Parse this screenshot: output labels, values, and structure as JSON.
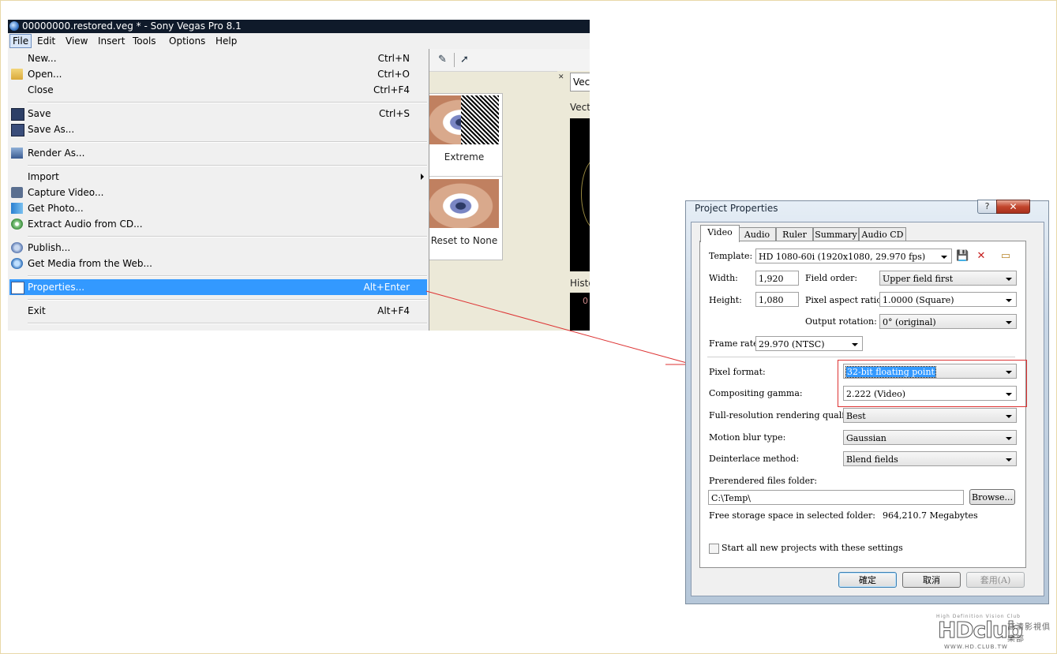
{
  "vegas": {
    "title": "00000000.restored.veg * - Sony Vegas Pro 8.1",
    "menubar": [
      "File",
      "Edit",
      "View",
      "Insert",
      "Tools",
      "Options",
      "Help"
    ],
    "file_menu": [
      {
        "label": "New...",
        "shortcut": "Ctrl+N",
        "icon": "new-icon"
      },
      {
        "label": "Open...",
        "shortcut": "Ctrl+O",
        "icon": "folder-icon"
      },
      {
        "label": "Close",
        "shortcut": "Ctrl+F4",
        "icon": ""
      },
      {
        "label": "Save",
        "shortcut": "Ctrl+S",
        "icon": "disk-icon"
      },
      {
        "label": "Save As...",
        "shortcut": "",
        "icon": "save-as-icon"
      },
      {
        "label": "Render As...",
        "shortcut": "",
        "icon": "render-icon"
      },
      {
        "label": "Import",
        "shortcut": "",
        "icon": "",
        "submenu": true
      },
      {
        "label": "Capture Video...",
        "shortcut": "",
        "icon": "camera-icon"
      },
      {
        "label": "Get Photo...",
        "shortcut": "",
        "icon": "photo-icon"
      },
      {
        "label": "Extract Audio from CD...",
        "shortcut": "",
        "icon": "cd-icon"
      },
      {
        "label": "Publish...",
        "shortcut": "",
        "icon": "publish-icon"
      },
      {
        "label": "Get Media from the Web...",
        "shortcut": "",
        "icon": "web-icon"
      },
      {
        "label": "Properties...",
        "shortcut": "Alt+Enter",
        "icon": "properties-icon",
        "highlighted": true
      },
      {
        "label": "Exit",
        "shortcut": "Alt+F4",
        "icon": ""
      }
    ],
    "presets": [
      "Extreme",
      "Reset to None"
    ],
    "scope": {
      "tab": "Vec",
      "section1": "Vect",
      "section2": "Histo",
      "zero": "0"
    }
  },
  "dialog": {
    "title": "Project Properties",
    "help_label": "?",
    "close_label": "✕",
    "tabs": [
      "Video",
      "Audio",
      "Ruler",
      "Summary",
      "Audio CD"
    ],
    "template_label": "Template:",
    "template_value": "HD 1080-60i (1920x1080, 29.970 fps)",
    "width_label": "Width:",
    "width_value": "1,920",
    "height_label": "Height:",
    "height_value": "1,080",
    "field_order_label": "Field order:",
    "field_order_value": "Upper field first",
    "par_label": "Pixel aspect ratio:",
    "par_value": "1.0000 (Square)",
    "rotation_label": "Output rotation:",
    "rotation_value": "0° (original)",
    "frame_rate_label": "Frame rate:",
    "frame_rate_value": "29.970 (NTSC)",
    "pixel_format_label": "Pixel format:",
    "pixel_format_value": "32-bit floating point",
    "gamma_label": "Compositing gamma:",
    "gamma_value": "2.222 (Video)",
    "quality_label": "Full-resolution rendering quality:",
    "quality_value": "Best",
    "motion_blur_label": "Motion blur type:",
    "motion_blur_value": "Gaussian",
    "deinterlace_label": "Deinterlace method:",
    "deinterlace_value": "Blend fields",
    "prerender_label": "Prerendered files folder:",
    "prerender_value": "C:\\Temp\\",
    "browse_label": "Browse...",
    "free_space_label": "Free storage space in selected folder:",
    "free_space_value": "964,210.7 Megabytes",
    "start_all_label": "Start all new projects with these settings",
    "ok_label": "確定",
    "cancel_label": "取消",
    "apply_label": "套用(A)"
  },
  "colors": {
    "highlight": "#3399ff",
    "annotation": "#dd3333"
  },
  "watermark": {
    "tagline": "High Definition Vision Club",
    "logo": "HDclub",
    "chinese": "高清影視俱樂部",
    "url": "WWW.HD.CLUB.TW"
  }
}
